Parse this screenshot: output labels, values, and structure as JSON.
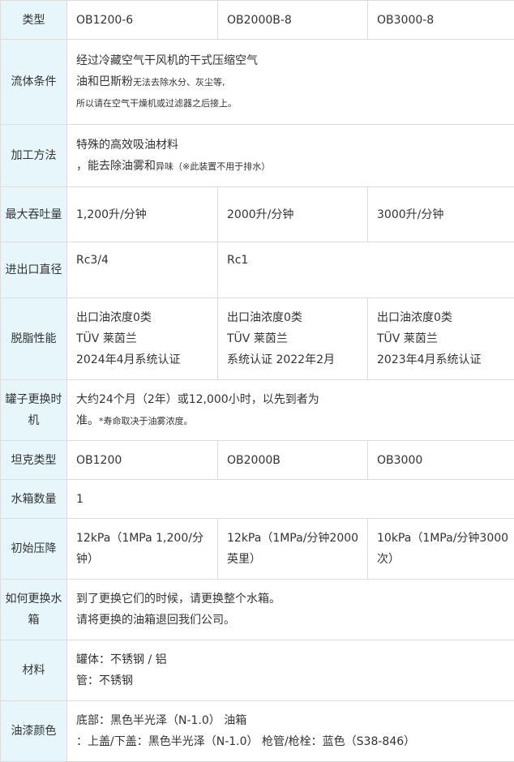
{
  "table": {
    "type_header": "类型",
    "models": [
      "OB1200-6",
      "OB2000B-8",
      "OB3000-8"
    ],
    "fluid": {
      "header": "流体条件",
      "line1": "经过冷藏空气干风机的干式压缩空气",
      "line2_main": "油和巴斯粉",
      "line2_small": "无法去除水分、灰尘等,",
      "line3_small": "所以请在空气干燥机或过滤器之后接上。"
    },
    "method": {
      "header": "加工方法",
      "line1": "特殊的高效吸油材料",
      "line2_main": "，能去除油雾和",
      "line2_small": "异味（※此装置不用于排水）"
    },
    "throughput": {
      "header": "最大吞吐量",
      "values": [
        "1,200升/分钟",
        "2000升/分钟",
        "3000升/分钟"
      ]
    },
    "port": {
      "header": "进出口直径",
      "values": [
        "Rc3/4",
        "Rc1"
      ]
    },
    "degrease": {
      "header": "脱脂性能",
      "cells": [
        [
          "出口油浓度0类",
          "TÜV 莱茵兰",
          "2024年4月系统认证"
        ],
        [
          "出口油浓度0类",
          "TÜV 莱茵兰",
          "系统认证 2022年2月"
        ],
        [
          "出口油浓度0类",
          "TÜV 莱茵兰",
          "2023年4月系统认证"
        ]
      ]
    },
    "replace_time": {
      "header": "罐子更换时机",
      "line1": "大约24个月（2年）或12,000小时，以先到者为",
      "line2_main": "准。",
      "line2_small": "*寿命取决于油雾浓度。"
    },
    "tank_type": {
      "header": "坦克类型",
      "values": [
        "OB1200",
        "OB2000B",
        "OB3000"
      ]
    },
    "tank_count": {
      "header": "水箱数量",
      "value": "1"
    },
    "pressure_drop": {
      "header": "初始压降",
      "values": [
        "12kPa（1MPa 1,200/分钟）",
        "12kPa（1MPa/分钟2000英里）",
        "10kPa（1MPa/分钟3000次）"
      ]
    },
    "how_replace": {
      "header": "如何更换水箱",
      "line1": "到了更换它们的时候，请更换整个水箱。",
      "line2": "请将更换的油箱退回我们公司。"
    },
    "material": {
      "header": "材料",
      "line1": "罐体：不锈钢 / 铝",
      "line2": "管：不锈钢"
    },
    "paint": {
      "header": "油漆颜色",
      "line1": "底部：黑色半光泽（N-1.0） 油箱",
      "line2": "：上盖/下盖：黑色半光泽（N-1.0） 枪管/枪栓：蓝色（S38-846）"
    }
  }
}
